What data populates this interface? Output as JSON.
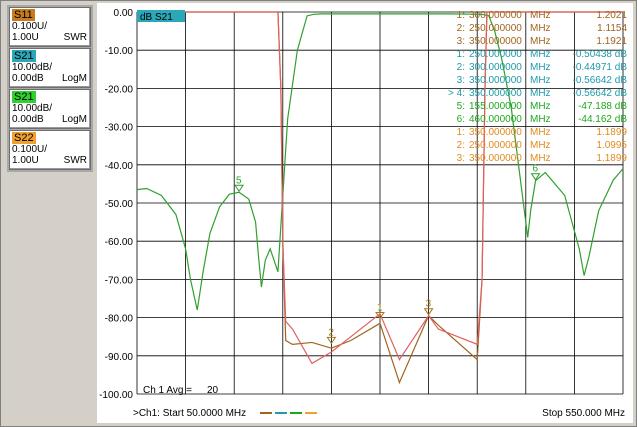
{
  "traces": [
    {
      "tag": "S11",
      "line2": "0.100U/",
      "line3": "1.00U",
      "format": "SWR",
      "tag_bg": "#c87a1e",
      "tag_color": "#000000"
    },
    {
      "tag": "S21",
      "line2": "10.00dB/",
      "line3": "0.00dB",
      "format": "LogM",
      "tag_bg": "#2aa7b8",
      "tag_color": "#000000"
    },
    {
      "tag": "S21",
      "line2": "10.00dB/",
      "line3": "0.00dB",
      "format": "LogM",
      "tag_bg": "#2fd12f",
      "tag_color": "#000000"
    },
    {
      "tag": "S22",
      "line2": "0.100U/",
      "line3": "1.00U",
      "format": "SWR",
      "tag_bg": "#f0a030",
      "tag_color": "#000000"
    }
  ],
  "active_trace_label": "dB S21",
  "y_axis_labels": [
    "0.00",
    "-10.00",
    "-20.00",
    "-30.00",
    "-40.00",
    "-50.00",
    "-60.00",
    "-70.00",
    "-80.00",
    "-90.00",
    "-100.00"
  ],
  "marker_table": [
    {
      "num": "1:",
      "freq": "300.000000",
      "unit": "MHz",
      "value": "1.2021",
      "color": "#a0641e"
    },
    {
      "num": "2:",
      "freq": "250.000000",
      "unit": "MHz",
      "value": "1.1154",
      "color": "#a0641e"
    },
    {
      "num": "3:",
      "freq": "350.000000",
      "unit": "MHz",
      "value": "1.1921",
      "color": "#a0641e"
    },
    {
      "num": "1:",
      "freq": "250.000000",
      "unit": "MHz",
      "value": "-0.50438 dB",
      "color": "#1e9aa8"
    },
    {
      "num": "2:",
      "freq": "300.000000",
      "unit": "MHz",
      "value": "-0.44971 dB",
      "color": "#1e9aa8"
    },
    {
      "num": "3:",
      "freq": "350.000000",
      "unit": "MHz",
      "value": "-0.56642 dB",
      "color": "#1e9aa8"
    },
    {
      "num": "> 4:",
      "freq": "350.000000",
      "unit": "MHz",
      "value": "-0.56642 dB",
      "color": "#1e9aa8"
    },
    {
      "num": "5:",
      "freq": "155.000000",
      "unit": "MHz",
      "value": "-47.188 dB",
      "color": "#1ea81e"
    },
    {
      "num": "6:",
      "freq": "460.000000",
      "unit": "MHz",
      "value": "-44.162 dB",
      "color": "#1ea81e"
    },
    {
      "num": "1:",
      "freq": "350.000000",
      "unit": "MHz",
      "value": "1.1899",
      "color": "#e08a1e"
    },
    {
      "num": "2:",
      "freq": "250.000000",
      "unit": "MHz",
      "value": "1.0995",
      "color": "#e08a1e"
    },
    {
      "num": "3:",
      "freq": "350.000000",
      "unit": "MHz",
      "value": "1.1899",
      "color": "#e08a1e"
    }
  ],
  "avg_label": "Ch 1 Avg =",
  "avg_value": "20",
  "start_text": ">Ch1: Start  50.0000 MHz",
  "stop_text": "Stop  550.000 MHz",
  "legend_dash_colors": [
    "#a0641e",
    "#1e9aa8",
    "#1ea81e",
    "#f0a030"
  ],
  "marker_labels": [
    "5",
    "6",
    "1",
    "2",
    "3"
  ],
  "chart_data": {
    "type": "line",
    "x_unit": "MHz",
    "x_range": [
      50,
      550
    ],
    "y_range": [
      -100,
      0
    ],
    "y_ticks": [
      0,
      -10,
      -20,
      -30,
      -40,
      -50,
      -60,
      -70,
      -80,
      -90,
      -100
    ],
    "grid": true,
    "series": [
      {
        "name": "S21",
        "color": "#2fa02f",
        "x": [
          50,
          60,
          75,
          90,
          100,
          105,
          112,
          118,
          125,
          135,
          145,
          155,
          165,
          172,
          175,
          178,
          182,
          187,
          195,
          205,
          215,
          225,
          232,
          240,
          260,
          290,
          330,
          370,
          405,
          412,
          418,
          425,
          435,
          445,
          452,
          455,
          460,
          470,
          490,
          505,
          510,
          515,
          525,
          540,
          550
        ],
        "y": [
          -46.5,
          -46.2,
          -48,
          -53,
          -62,
          -70,
          -78,
          -68,
          -58,
          -51,
          -47.7,
          -47.2,
          -49,
          -55,
          -64,
          -72,
          -65,
          -62,
          -68,
          -28,
          -10,
          -1,
          -0.6,
          -0.5,
          -0.5,
          -0.5,
          -0.5,
          -0.5,
          -0.6,
          -1,
          -5,
          -12,
          -25,
          -45,
          -59,
          -52,
          -44.2,
          -42,
          -48,
          -62,
          -69,
          -64,
          -52,
          -44,
          -41
        ]
      },
      {
        "name": "S11",
        "color": "#a0641e",
        "x": [
          50,
          195,
          198,
          200,
          203,
          210,
          230,
          250,
          270,
          300,
          320,
          350,
          360,
          400,
          405,
          408,
          410,
          550
        ],
        "y": [
          0,
          0,
          -20,
          -60,
          -86,
          -87,
          -86.5,
          -88,
          -86,
          -81.5,
          -97,
          -79.5,
          -82,
          -91,
          -70,
          -20,
          0,
          0
        ]
      },
      {
        "name": "S22",
        "color": "#e06060",
        "x": [
          50,
          195,
          198,
          200,
          203,
          210,
          230,
          250,
          270,
          300,
          320,
          350,
          360,
          400,
          405,
          408,
          410,
          550
        ],
        "y": [
          0,
          0,
          -20,
          -60,
          -81,
          -83,
          -92,
          -89,
          -85,
          -79,
          -91,
          -79.5,
          -83,
          -87,
          -70,
          -20,
          0,
          0
        ]
      }
    ],
    "markers": [
      {
        "label": "5",
        "x": 155,
        "y": -47.188,
        "series": "S21"
      },
      {
        "label": "6",
        "x": 460,
        "y": -44.162,
        "series": "S21"
      },
      {
        "label": "1",
        "x": 300,
        "y": -80.5,
        "series": "S11"
      },
      {
        "label": "2",
        "x": 250,
        "y": -87,
        "series": "S11"
      },
      {
        "label": "3",
        "x": 350,
        "y": -79.5,
        "series": "S11"
      }
    ]
  }
}
